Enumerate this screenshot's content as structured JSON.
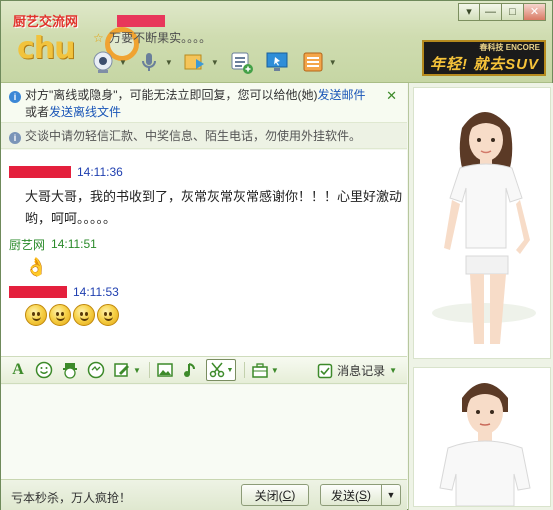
{
  "window": {
    "logo_text": "厨艺交流网",
    "logo_sub": "",
    "watermark": "chu",
    "status_text": "万要不断果实。。。。",
    "controls": [
      "▾",
      "—",
      "□",
      "✕"
    ]
  },
  "top_toolbar": {
    "icons": [
      "video-icon",
      "voice-icon",
      "file-transfer-icon",
      "app-list-icon",
      "remote-desktop-icon",
      "more-apps-icon"
    ]
  },
  "ad": {
    "small": "春科技 ENCORE",
    "big": "年轻! 就去SUV"
  },
  "notice": {
    "prefix": "对方\"离线或隐身\"，可能无法立即回复，您可以给他(她)",
    "link1": "发送邮件",
    "middle": "或者",
    "link2": "发送离线文件",
    "close": "✕"
  },
  "safety": {
    "text": "交谈中请勿轻信汇款、中奖信息、陌生电话，勿使用外挂软件。"
  },
  "messages": [
    {
      "time": "14:11:36",
      "text": "大哥大哥，我的书收到了，灰常灰常灰常感谢你！！！心里好激动哟，呵呵。。。。。"
    },
    {
      "sender": "厨艺网",
      "time": "14:11:51",
      "text": "👌"
    },
    {
      "time": "14:11:53",
      "smiles": 4
    }
  ],
  "input_toolbar": {
    "history_label": "消息记录"
  },
  "footer": {
    "slogan": "亏本秒杀，万人疯抢！",
    "close_label": "关闭(",
    "close_key": "C",
    "close_end": ")",
    "send_label": "发送(",
    "send_key": "S",
    "send_end": ")"
  },
  "colors": {
    "accent_green": "#3d8a2a",
    "link_blue": "#1a56b8",
    "time_blue": "#1f3fb0",
    "mask_red": "#e4203d"
  }
}
